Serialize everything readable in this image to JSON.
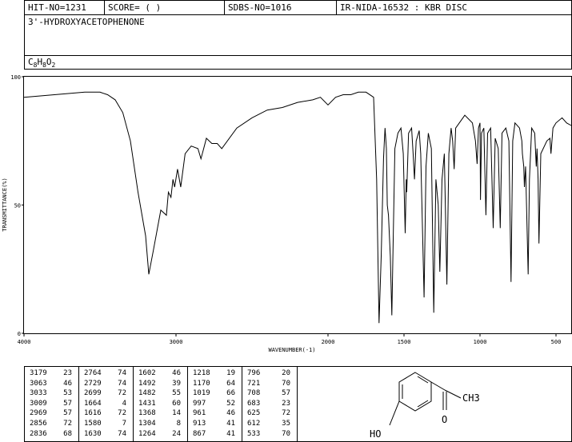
{
  "header": {
    "hit_no": "HIT-NO=1231",
    "score": "SCORE=  (    )",
    "sdbs_no": "SDBS-NO=1016",
    "ir_info": "IR-NIDA-16532 : KBR DISC"
  },
  "compound": {
    "name": "3'-HYDROXYACETOPHENONE",
    "formula_parts": [
      "C",
      "8",
      "H",
      "8",
      "O",
      "2"
    ]
  },
  "chart_data": {
    "type": "line",
    "xlabel": "WAVENUMBER(-1)",
    "ylabel": "TRANSMITTANCE(%)",
    "xlim": [
      4000,
      400
    ],
    "ylim": [
      0,
      100
    ],
    "x_ticks": [
      "4000",
      "3000",
      "2000",
      "1500",
      "1000",
      "500"
    ],
    "y_ticks": [
      "0",
      "50",
      "100"
    ],
    "grid": false,
    "spectrum": [
      [
        4000,
        92
      ],
      [
        3800,
        93
      ],
      [
        3600,
        94
      ],
      [
        3500,
        94
      ],
      [
        3450,
        93
      ],
      [
        3400,
        91
      ],
      [
        3350,
        86
      ],
      [
        3300,
        75
      ],
      [
        3250,
        55
      ],
      [
        3200,
        38
      ],
      [
        3179,
        23
      ],
      [
        3150,
        32
      ],
      [
        3100,
        48
      ],
      [
        3063,
        46
      ],
      [
        3050,
        55
      ],
      [
        3033,
        53
      ],
      [
        3020,
        60
      ],
      [
        3009,
        57
      ],
      [
        2990,
        64
      ],
      [
        2969,
        57
      ],
      [
        2940,
        70
      ],
      [
        2900,
        73
      ],
      [
        2856,
        72
      ],
      [
        2836,
        68
      ],
      [
        2800,
        76
      ],
      [
        2764,
        74
      ],
      [
        2729,
        74
      ],
      [
        2699,
        72
      ],
      [
        2600,
        80
      ],
      [
        2500,
        84
      ],
      [
        2400,
        87
      ],
      [
        2300,
        88
      ],
      [
        2200,
        90
      ],
      [
        2100,
        91
      ],
      [
        2050,
        92
      ],
      [
        2000,
        89
      ],
      [
        1950,
        92
      ],
      [
        1900,
        93
      ],
      [
        1850,
        93
      ],
      [
        1800,
        94
      ],
      [
        1750,
        94
      ],
      [
        1700,
        92
      ],
      [
        1680,
        60
      ],
      [
        1664,
        4
      ],
      [
        1650,
        30
      ],
      [
        1635,
        68
      ],
      [
        1630,
        74
      ],
      [
        1625,
        80
      ],
      [
        1616,
        72
      ],
      [
        1610,
        50
      ],
      [
        1602,
        46
      ],
      [
        1590,
        30
      ],
      [
        1580,
        7
      ],
      [
        1570,
        40
      ],
      [
        1560,
        72
      ],
      [
        1540,
        78
      ],
      [
        1520,
        80
      ],
      [
        1505,
        70
      ],
      [
        1492,
        39
      ],
      [
        1485,
        60
      ],
      [
        1482,
        55
      ],
      [
        1470,
        78
      ],
      [
        1450,
        80
      ],
      [
        1440,
        70
      ],
      [
        1431,
        60
      ],
      [
        1420,
        75
      ],
      [
        1400,
        79
      ],
      [
        1390,
        70
      ],
      [
        1368,
        14
      ],
      [
        1355,
        65
      ],
      [
        1340,
        78
      ],
      [
        1320,
        72
      ],
      [
        1304,
        8
      ],
      [
        1290,
        60
      ],
      [
        1275,
        50
      ],
      [
        1264,
        24
      ],
      [
        1250,
        60
      ],
      [
        1235,
        70
      ],
      [
        1218,
        19
      ],
      [
        1205,
        70
      ],
      [
        1190,
        80
      ],
      [
        1180,
        75
      ],
      [
        1170,
        64
      ],
      [
        1160,
        80
      ],
      [
        1100,
        85
      ],
      [
        1050,
        82
      ],
      [
        1030,
        75
      ],
      [
        1019,
        66
      ],
      [
        1010,
        80
      ],
      [
        1000,
        82
      ],
      [
        997,
        52
      ],
      [
        990,
        78
      ],
      [
        975,
        80
      ],
      [
        961,
        46
      ],
      [
        950,
        78
      ],
      [
        930,
        80
      ],
      [
        913,
        41
      ],
      [
        900,
        76
      ],
      [
        880,
        72
      ],
      [
        867,
        41
      ],
      [
        855,
        78
      ],
      [
        830,
        80
      ],
      [
        810,
        75
      ],
      [
        796,
        20
      ],
      [
        785,
        75
      ],
      [
        770,
        82
      ],
      [
        740,
        80
      ],
      [
        725,
        75
      ],
      [
        721,
        70
      ],
      [
        712,
        65
      ],
      [
        708,
        57
      ],
      [
        700,
        65
      ],
      [
        690,
        40
      ],
      [
        683,
        23
      ],
      [
        675,
        60
      ],
      [
        660,
        80
      ],
      [
        640,
        78
      ],
      [
        630,
        65
      ],
      [
        625,
        72
      ],
      [
        618,
        60
      ],
      [
        612,
        35
      ],
      [
        600,
        70
      ],
      [
        560,
        75
      ],
      [
        540,
        76
      ],
      [
        533,
        70
      ],
      [
        520,
        80
      ],
      [
        500,
        82
      ],
      [
        460,
        84
      ],
      [
        430,
        82
      ],
      [
        400,
        81
      ]
    ],
    "peak_table": [
      [
        [
          "3179",
          "23"
        ],
        [
          "3063",
          "46"
        ],
        [
          "3033",
          "53"
        ],
        [
          "3009",
          "57"
        ],
        [
          "2969",
          "57"
        ],
        [
          "2856",
          "72"
        ],
        [
          "2836",
          "68"
        ]
      ],
      [
        [
          "2764",
          "74"
        ],
        [
          "2729",
          "74"
        ],
        [
          "2699",
          "72"
        ],
        [
          "1664",
          "4"
        ],
        [
          "1616",
          "72"
        ],
        [
          "1580",
          "7"
        ],
        [
          "1630",
          "74"
        ]
      ],
      [
        [
          "1602",
          "46"
        ],
        [
          "1492",
          "39"
        ],
        [
          "1482",
          "55"
        ],
        [
          "1431",
          "60"
        ],
        [
          "1368",
          "14"
        ],
        [
          "1304",
          "8"
        ],
        [
          "1264",
          "24"
        ]
      ],
      [
        [
          "1218",
          "19"
        ],
        [
          "1170",
          "64"
        ],
        [
          "1019",
          "66"
        ],
        [
          "997",
          "52"
        ],
        [
          "961",
          "46"
        ],
        [
          "913",
          "41"
        ],
        [
          "867",
          "41"
        ]
      ],
      [
        [
          "796",
          "20"
        ],
        [
          "721",
          "70"
        ],
        [
          "708",
          "57"
        ],
        [
          "683",
          "23"
        ],
        [
          "625",
          "72"
        ],
        [
          "612",
          "35"
        ],
        [
          "533",
          "70"
        ]
      ]
    ]
  },
  "structure": {
    "label_oh": "HO",
    "label_o": "O",
    "label_ch3": "CH3"
  }
}
